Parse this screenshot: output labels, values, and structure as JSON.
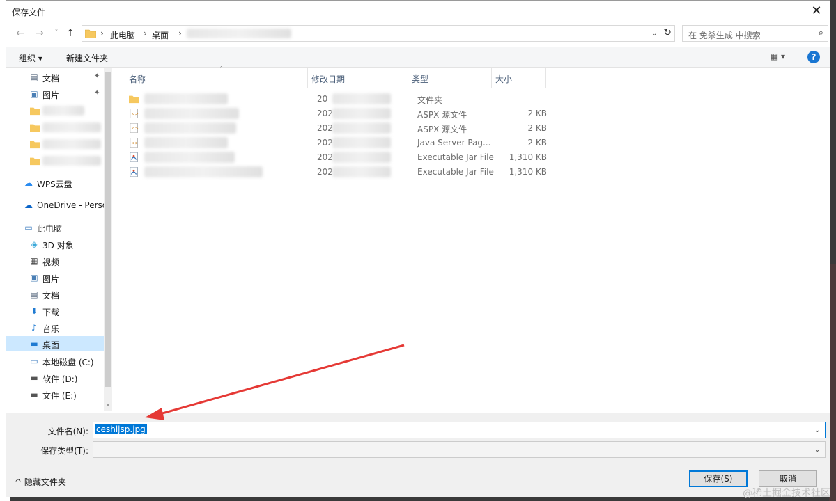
{
  "window": {
    "title": "保存文件",
    "close_glyph": "✕"
  },
  "nav": {
    "back_glyph": "←",
    "forward_glyph": "→",
    "recent_glyph": "˅",
    "up_glyph": "↑",
    "breadcrumbs": [
      "此电脑",
      "桌面"
    ],
    "crumb_sep": "›",
    "dropdown_glyph": "⌄",
    "refresh_glyph": "↻"
  },
  "search": {
    "placeholder": "在 免杀生成 中搜索",
    "icon_glyph": "⌕"
  },
  "toolbar": {
    "organize_label": "组织 ▾",
    "new_folder_label": "新建文件夹",
    "view_glyph": "▦ ▾",
    "help_glyph": "?"
  },
  "sidebar": {
    "items": [
      {
        "label": "文档",
        "icon": "document-icon",
        "glyph": "▤"
      },
      {
        "label": "图片",
        "icon": "picture-icon",
        "glyph": "▣"
      },
      {
        "label": "WPS云盘",
        "icon": "cloud-icon",
        "glyph": "☁"
      },
      {
        "label": "OneDrive - Personal",
        "icon": "onedrive-icon",
        "glyph": "☁"
      },
      {
        "label": "此电脑",
        "icon": "computer-icon",
        "glyph": "▭"
      },
      {
        "label": "3D 对象",
        "icon": "cube-icon",
        "glyph": "◈"
      },
      {
        "label": "视频",
        "icon": "video-icon",
        "glyph": "▦"
      },
      {
        "label": "图片",
        "icon": "picture-icon",
        "glyph": "▣"
      },
      {
        "label": "文档",
        "icon": "document-icon",
        "glyph": "▤"
      },
      {
        "label": "下载",
        "icon": "download-icon",
        "glyph": "⬇"
      },
      {
        "label": "音乐",
        "icon": "music-icon",
        "glyph": "♪"
      },
      {
        "label": "桌面",
        "icon": "desktop-icon",
        "glyph": "▬"
      },
      {
        "label": "本地磁盘 (C:)",
        "icon": "disk-icon",
        "glyph": "▭"
      },
      {
        "label": "软件 (D:)",
        "icon": "drive-icon",
        "glyph": "▬"
      },
      {
        "label": "文件 (E:)",
        "icon": "drive-icon",
        "glyph": "▬"
      }
    ],
    "pin_glyph": "📌"
  },
  "columns": {
    "name": "名称",
    "date": "修改日期",
    "type": "类型",
    "size": "大小"
  },
  "files": [
    {
      "date": "20",
      "type": "文件夹",
      "size": ""
    },
    {
      "date": "202",
      "type": "ASPX 源文件",
      "size": "2 KB"
    },
    {
      "date": "202",
      "type": "ASPX 源文件",
      "size": "2 KB"
    },
    {
      "date": "202",
      "type": "Java Server Pag...",
      "size": "2 KB"
    },
    {
      "date": "202",
      "type": "Executable Jar File",
      "size": "1,310 KB"
    },
    {
      "date": "202",
      "type": "Executable Jar File",
      "size": "1,310 KB"
    }
  ],
  "save": {
    "filename_label": "文件名(N):",
    "filename_value": "ceshijsp.jpg",
    "filetype_label": "保存类型(T):",
    "hide_folders_label": "^ 隐藏文件夹",
    "save_button": "保存(S)",
    "cancel_button": "取消"
  },
  "watermark": "@稀土掘金技术社区",
  "colors": {
    "accent": "#0078d7",
    "selection": "#cce8ff",
    "arrow": "#e53935",
    "folder": "#f6c85f"
  }
}
